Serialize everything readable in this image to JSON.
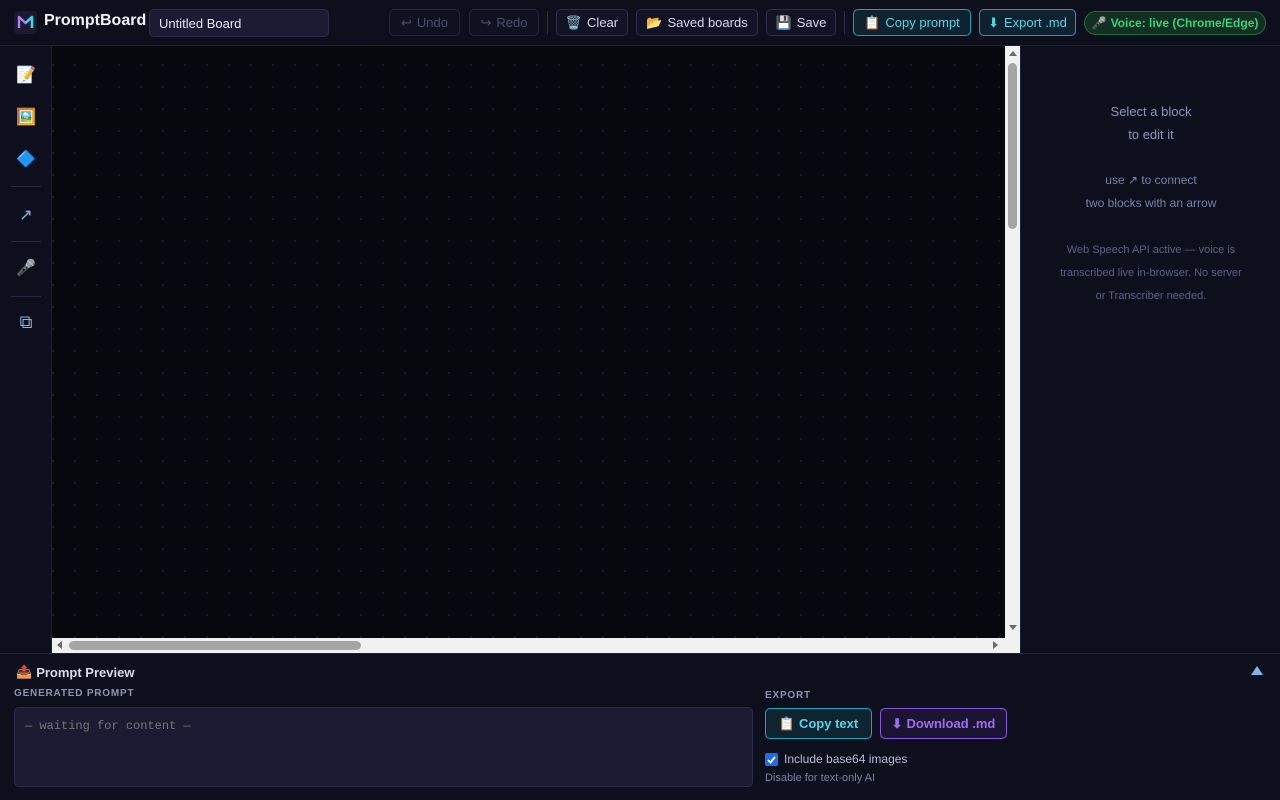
{
  "app": {
    "name": "PromptBoard",
    "board_name": "Untitled Board"
  },
  "toolbar": {
    "undo": "Undo",
    "redo": "Redo",
    "clear": "Clear",
    "saved_boards": "Saved boards",
    "save": "Save",
    "copy_prompt": "Copy prompt",
    "export_md": "Export .md",
    "voice_status": "Voice: live (Chrome/Edge)",
    "undo_enabled": false,
    "redo_enabled": false
  },
  "tools": [
    {
      "name": "note-tool",
      "icon": "memo-icon",
      "glyph": "📝"
    },
    {
      "name": "image-tool",
      "icon": "picture-icon",
      "glyph": "🖼️"
    },
    {
      "name": "shape-tool",
      "icon": "diamond-icon",
      "glyph": "🔷"
    },
    {
      "name": "arrow-tool",
      "icon": "arrow-icon",
      "glyph": "↗"
    },
    {
      "name": "voice-tool",
      "icon": "microphone-icon",
      "glyph": "🎤"
    },
    {
      "name": "duplicate-tool",
      "icon": "duplicate-icon",
      "glyph": "⧉"
    }
  ],
  "side_panel": {
    "line1": "Select a block",
    "line2": "to edit it",
    "line3": "use ↗ to connect",
    "line4": "two blocks with an arrow",
    "note1": "Web Speech API active — voice is",
    "note2": "transcribed live in-browser. No server",
    "note3": "or Transcriber needed."
  },
  "preview": {
    "title": "Prompt Preview",
    "generated_label": "GENERATED PROMPT",
    "placeholder": "— waiting for content —",
    "export_label": "EXPORT",
    "copy_text": "Copy text",
    "download_md": "Download .md",
    "include_images": "Include base64 images",
    "include_images_checked": true,
    "hint": "Disable for text-only AI"
  },
  "colors": {
    "accent_cyan": "#4fd6e6",
    "accent_purple": "#a06cf0",
    "voice_green": "#34d27b",
    "background": "#07070e"
  }
}
